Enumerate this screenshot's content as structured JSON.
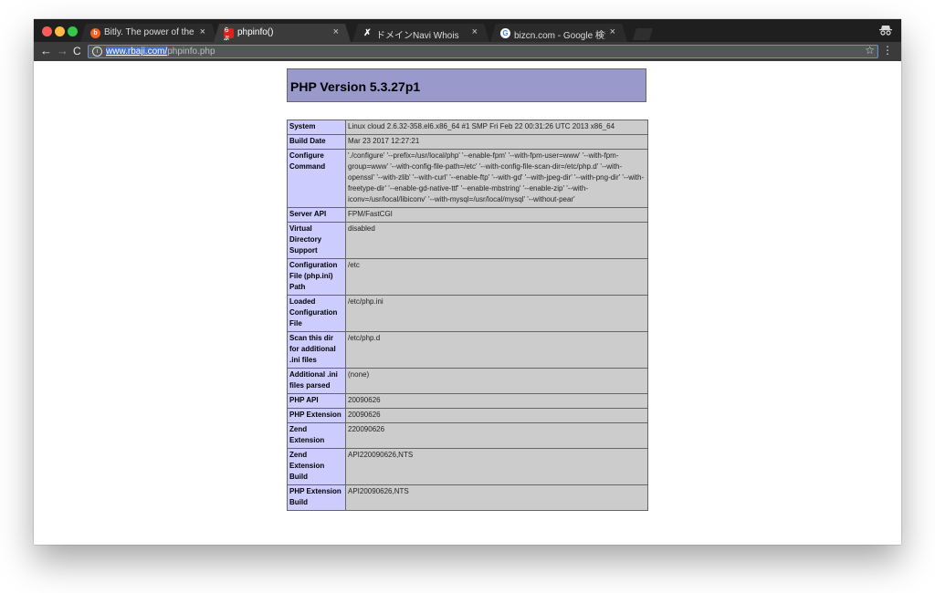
{
  "tabs": [
    {
      "title": "Bitly. The power of the link.",
      "favicon": "bitly-icon",
      "favicon_color": "#ee6123"
    },
    {
      "title": "phpinfo()",
      "favicon": "red-badge-icon",
      "favicon_text": "らぶ",
      "favicon_color": "#e02020",
      "active": true
    },
    {
      "title": "ドメインNavi Whois",
      "favicon": "domain-navi-icon"
    },
    {
      "title": "bizcn.com - Google 検索",
      "favicon": "google-icon"
    }
  ],
  "address_bar": {
    "url_host": "www.rbaji.com/",
    "url_path": "phpinfo.php"
  },
  "page": {
    "header": "PHP Version 5.3.27p1",
    "rows": [
      {
        "key": "System",
        "value": "Linux cloud 2.6.32-358.el6.x86_64 #1 SMP Fri Feb 22 00:31:26 UTC 2013 x86_64"
      },
      {
        "key": "Build Date",
        "value": "Mar 23 2017 12:27:21"
      },
      {
        "key": "Configure Command",
        "value": "'./configure' '--prefix=/usr/local/php' '--enable-fpm' '--with-fpm-user=www' '--with-fpm-group=www' '--with-config-file-path=/etc' '--with-config-file-scan-dir=/etc/php.d' '--with-openssl' '--with-zlib' '--with-curl' '--enable-ftp' '--with-gd' '--with-jpeg-dir' '--with-png-dir' '--with-freetype-dir' '--enable-gd-native-ttf' '--enable-mbstring' '--enable-zip' '--with-iconv=/usr/local/libiconv' '--with-mysql=/usr/local/mysql' '--without-pear'"
      },
      {
        "key": "Server API",
        "value": "FPM/FastCGI"
      },
      {
        "key": "Virtual Directory Support",
        "value": "disabled"
      },
      {
        "key": "Configuration File (php.ini) Path",
        "value": "/etc"
      },
      {
        "key": "Loaded Configuration File",
        "value": "/etc/php.ini"
      },
      {
        "key": "Scan this dir for additional .ini files",
        "value": "/etc/php.d"
      },
      {
        "key": "Additional .ini files parsed",
        "value": "(none)"
      },
      {
        "key": "PHP API",
        "value": "20090626"
      },
      {
        "key": "PHP Extension",
        "value": "20090626"
      },
      {
        "key": "Zend Extension",
        "value": "220090626"
      },
      {
        "key": "Zend Extension Build",
        "value": "API220090626,NTS"
      },
      {
        "key": "PHP Extension Build",
        "value": "API20090626,NTS"
      }
    ]
  }
}
